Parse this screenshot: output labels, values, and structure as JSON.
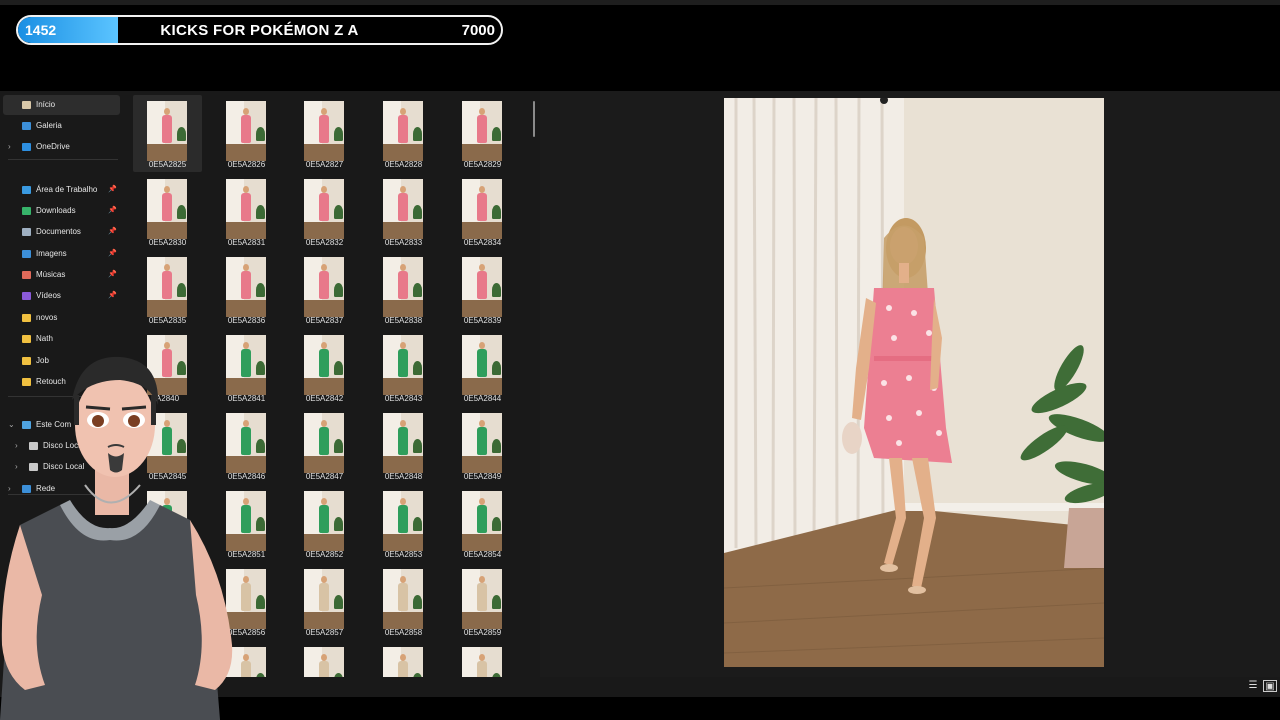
{
  "stream_overlay": {
    "count": "1452",
    "title": "KICKS FOR POKÉMON Z A",
    "goal": "7000",
    "progress_fraction": 0.207,
    "accent_color": "#1a8fe3"
  },
  "sidebar": {
    "items": [
      {
        "label": "Início",
        "icon": "home-icon",
        "selected": true
      },
      {
        "label": "Galeria",
        "icon": "gallery-icon"
      },
      {
        "label": "OneDrive",
        "icon": "onedrive-cloud-icon",
        "expandable": true
      },
      {
        "label": "Área de Trabalho",
        "icon": "desktop-icon",
        "pinned": true
      },
      {
        "label": "Downloads",
        "icon": "download-icon",
        "pinned": true
      },
      {
        "label": "Documentos",
        "icon": "documents-icon",
        "pinned": true
      },
      {
        "label": "Imagens",
        "icon": "pictures-icon",
        "pinned": true
      },
      {
        "label": "Músicas",
        "icon": "music-icon",
        "pinned": true
      },
      {
        "label": "Vídeos",
        "icon": "videos-icon",
        "pinned": true
      },
      {
        "label": "novos",
        "icon": "folder-icon"
      },
      {
        "label": "Nath",
        "icon": "folder-icon"
      },
      {
        "label": "Job",
        "icon": "folder-icon"
      },
      {
        "label": "Retouch",
        "icon": "folder-icon"
      },
      {
        "label": "Este Com",
        "icon": "this-pc-icon",
        "expanded": true
      },
      {
        "label": "Disco Local",
        "icon": "drive-icon",
        "expandable": true
      },
      {
        "label": "Disco Local",
        "icon": "drive-icon",
        "expandable": true
      },
      {
        "label": "Rede",
        "icon": "network-icon",
        "expandable": true
      }
    ]
  },
  "files": {
    "items": [
      {
        "name": "0E5A2825",
        "dress": "pink",
        "selected": true
      },
      {
        "name": "0E5A2826",
        "dress": "pink"
      },
      {
        "name": "0E5A2827",
        "dress": "pink"
      },
      {
        "name": "0E5A2828",
        "dress": "pink"
      },
      {
        "name": "0E5A2829",
        "dress": "pink"
      },
      {
        "name": "0E5A2830",
        "dress": "pink"
      },
      {
        "name": "0E5A2831",
        "dress": "pink"
      },
      {
        "name": "0E5A2832",
        "dress": "pink"
      },
      {
        "name": "0E5A2833",
        "dress": "pink"
      },
      {
        "name": "0E5A2834",
        "dress": "pink"
      },
      {
        "name": "0E5A2835",
        "dress": "pink"
      },
      {
        "name": "0E5A2836",
        "dress": "pink"
      },
      {
        "name": "0E5A2837",
        "dress": "pink"
      },
      {
        "name": "0E5A2838",
        "dress": "pink"
      },
      {
        "name": "0E5A2839",
        "dress": "pink"
      },
      {
        "name": "A2840",
        "dress": "pink"
      },
      {
        "name": "0E5A2841",
        "dress": "green"
      },
      {
        "name": "0E5A2842",
        "dress": "green"
      },
      {
        "name": "0E5A2843",
        "dress": "green"
      },
      {
        "name": "0E5A2844",
        "dress": "green"
      },
      {
        "name": "0E5A2845",
        "dress": "green"
      },
      {
        "name": "0E5A2846",
        "dress": "green"
      },
      {
        "name": "0E5A2847",
        "dress": "green"
      },
      {
        "name": "0E5A2848",
        "dress": "green"
      },
      {
        "name": "0E5A2849",
        "dress": "green"
      },
      {
        "name": "",
        "dress": "green"
      },
      {
        "name": "0E5A2851",
        "dress": "green"
      },
      {
        "name": "0E5A2852",
        "dress": "green"
      },
      {
        "name": "0E5A2853",
        "dress": "green"
      },
      {
        "name": "0E5A2854",
        "dress": "green"
      },
      {
        "name": "55",
        "dress": "beige"
      },
      {
        "name": "0E5A2856",
        "dress": "beige"
      },
      {
        "name": "0E5A2857",
        "dress": "beige"
      },
      {
        "name": "0E5A2858",
        "dress": "beige"
      },
      {
        "name": "0E5A2859",
        "dress": "beige"
      },
      {
        "name": "",
        "dress": "beige"
      },
      {
        "name": "",
        "dress": "beige"
      },
      {
        "name": "",
        "dress": "beige"
      },
      {
        "name": "",
        "dress": "beige"
      },
      {
        "name": "",
        "dress": "beige"
      }
    ]
  },
  "colors": {
    "dress_pink": "#e8798a",
    "dress_green": "#2f9e5c",
    "dress_beige": "#d8c3a5"
  },
  "statusbar": {
    "details_view_icon": "details-view-icon",
    "large_icons_view_icon": "large-icons-view-icon"
  }
}
